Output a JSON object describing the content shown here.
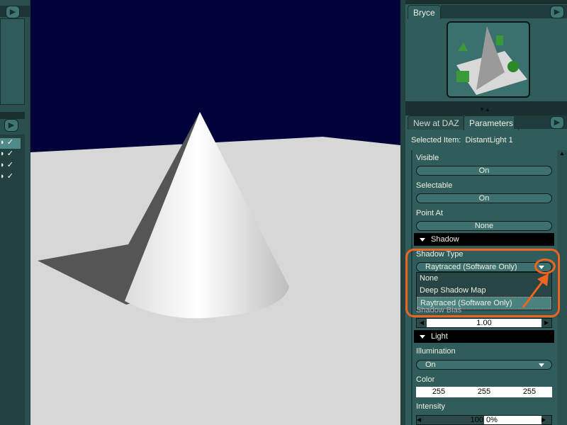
{
  "bryce_panel": {
    "tab": "Bryce"
  },
  "params_panel": {
    "tabs": [
      "New at DAZ",
      "Parameters"
    ],
    "selected_label": "Selected Item:",
    "selected_value": "DistantLight 1",
    "visible": {
      "label": "Visible",
      "value": "On"
    },
    "selectable": {
      "label": "Selectable",
      "value": "On"
    },
    "point_at": {
      "label": "Point At",
      "value": "None"
    },
    "shadow_section": "Shadow",
    "shadow_type": {
      "label": "Shadow Type",
      "value": "Raytraced (Software Only)",
      "options": [
        "None",
        "Deep Shadow Map",
        "Raytraced (Software Only)"
      ]
    },
    "shadow_bias": {
      "label": "Shadow Bias",
      "value": "1.00"
    },
    "light_section": "Light",
    "illumination": {
      "label": "Illumination",
      "value": "On"
    },
    "color": {
      "label": "Color",
      "r": "255",
      "g": "255",
      "b": "255"
    },
    "intensity": {
      "label": "Intensity",
      "value": "100",
      "unit": "0%",
      "fraction": 0.5
    }
  },
  "colors": {
    "highlight": "#f0641e",
    "panel": "#305d5c",
    "sky": "#02023a"
  }
}
